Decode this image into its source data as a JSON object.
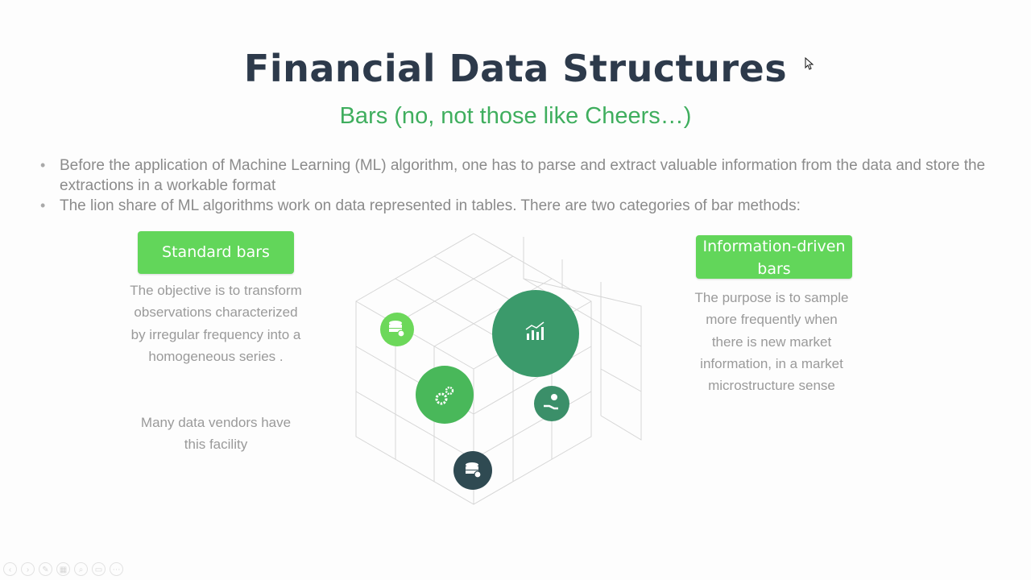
{
  "slide": {
    "title": "Financial Data Structures",
    "subtitle": "Bars (no, not those like Cheers…)",
    "bullets": [
      "Before the application of Machine Learning (ML) algorithm, one has to parse and extract valuable information from the data and store the extractions in a workable format",
      "The lion share of ML algorithms work on data represented in tables. There are two categories of bar methods:"
    ],
    "left_card": {
      "heading": "Standard bars",
      "text": "The objective is to transform observations characterized by irregular frequency into a homogeneous series .",
      "text2": "Many data vendors have this facility"
    },
    "right_card": {
      "heading": "Information-driven bars",
      "text": "The purpose is to sample more frequently when there is new market information, in a market microstructure sense"
    }
  },
  "diagram_icons": [
    "database-clock-icon",
    "chart-up-icon",
    "gears-icon",
    "money-hand-icon",
    "database-clock-icon"
  ],
  "colors": {
    "title": "#2d3a4b",
    "accent_green": "#3fae5e",
    "header_green": "#62d65a",
    "circle_light": "#6cd85a",
    "circle_mid": "#49b85a",
    "circle_dark": "#3b9a6b",
    "circle_navy": "#2f4a52",
    "body_text": "#8b8b8b"
  },
  "toolbar": {
    "buttons": [
      "previous-slide",
      "next-slide",
      "pen",
      "view",
      "zoom",
      "subtitles",
      "more"
    ]
  }
}
